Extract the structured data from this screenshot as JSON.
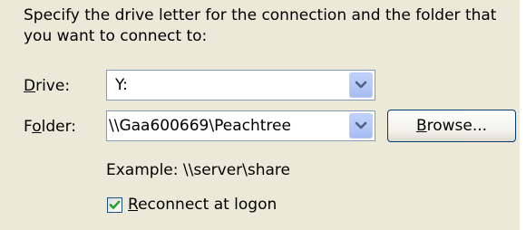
{
  "instructions": "Specify the drive letter for the connection and the folder that you want to connect to:",
  "drive": {
    "label_accel": "D",
    "label_rest": "rive:",
    "value": "Y:"
  },
  "folder": {
    "label_pre": "F",
    "label_accel": "o",
    "label_rest": "lder:",
    "value": "\\\\Gaa600669\\Peachtree"
  },
  "browse_button": {
    "label_accel": "B",
    "label_rest": "rowse..."
  },
  "example": "Example: \\\\server\\share",
  "reconnect": {
    "checked": true,
    "label_accel": "R",
    "label_rest": "econnect at logon"
  },
  "colors": {
    "panel_background": "#ece9d8",
    "field_border": "#7f9db9",
    "dropdown_button": "#b4c8f6",
    "check_mark": "#21a121"
  },
  "icons": {
    "dropdown_arrow": "chevron-down-icon",
    "check_mark": "checkmark-icon"
  }
}
